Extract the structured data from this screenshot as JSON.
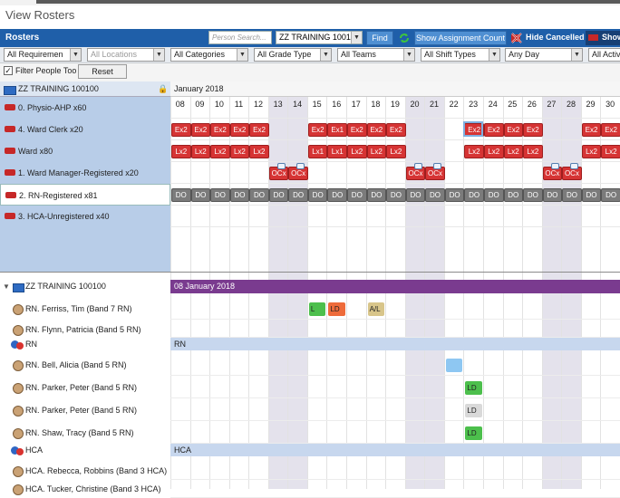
{
  "page_title": "View Rosters",
  "toolbar": {
    "title": "Rosters",
    "search_placeholder": "Person Search...",
    "roster_value": "ZZ TRAINING 10010",
    "find_label": "Find",
    "show_assignment_label": "Show Assignment Count",
    "hide_cancelled_label": "Hide Cancelled",
    "show_label": "Show"
  },
  "filters": {
    "dropdowns": [
      "All Requiremen",
      "All Locations",
      "All Categories",
      "All Grade Type",
      "All Teams",
      "All Shift Types",
      "Any Day",
      "All Activ"
    ],
    "filter_people_label": "Filter People Too",
    "reset_label": "Reset"
  },
  "requirements": {
    "group_name": "ZZ TRAINING 100100",
    "month_label": "January 2018",
    "days": [
      "08",
      "09",
      "10",
      "11",
      "12",
      "13",
      "14",
      "15",
      "16",
      "17",
      "18",
      "19",
      "20",
      "21",
      "22",
      "23",
      "24",
      "25",
      "26",
      "27",
      "28",
      "29",
      "30"
    ],
    "rows": [
      {
        "label": "0. Physio-AHP x60",
        "chips": [
          "",
          "",
          "",
          "",
          "",
          "",
          "",
          "",
          "",
          "",
          "",
          "",
          "",
          "",
          "",
          "",
          "",
          "",
          "",
          "",
          "",
          "",
          ""
        ]
      },
      {
        "label": "4. Ward Clerk x20",
        "chips": [
          "Ex2",
          "Ex2",
          "Ex2",
          "Ex2",
          "Ex2",
          "",
          "",
          "Ex2",
          "Ex1",
          "Ex2",
          "Ex2",
          "Ex2",
          "",
          "",
          "",
          "Ex2",
          "Ex2",
          "Ex2",
          "Ex2",
          "",
          "",
          "Ex2",
          "Ex2"
        ]
      },
      {
        "label": "Ward  x80",
        "chips": [
          "Lx2",
          "Lx2",
          "Lx2",
          "Lx2",
          "Lx2",
          "",
          "",
          "Lx1",
          "Lx1",
          "Lx2",
          "Lx2",
          "Lx2",
          "",
          "",
          "",
          "Lx2",
          "Lx2",
          "Lx2",
          "Lx2",
          "",
          "",
          "Lx2",
          "Lx2"
        ]
      },
      {
        "label": "1. Ward Manager-Registered x20",
        "chips": [
          "",
          "",
          "",
          "",
          "",
          "OCx",
          "OCx",
          "",
          "",
          "",
          "",
          "",
          "OCx",
          "OCx",
          "",
          "",
          "",
          "",
          "",
          "OCx",
          "OCx",
          "",
          ""
        ]
      },
      {
        "label": "2. RN-Registered x81",
        "chips": [
          "DO",
          "DO",
          "DO",
          "DO",
          "DO",
          "DO",
          "DO",
          "DO",
          "DO",
          "DO",
          "DO",
          "DO",
          "DO",
          "DO",
          "DO",
          "DO",
          "DO",
          "DO",
          "DO",
          "DO",
          "DO",
          "DO",
          "DO"
        ]
      },
      {
        "label": "3. HCA-Unregistered x40",
        "chips": [
          "",
          "",
          "",
          "",
          "",
          "",
          "",
          "",
          "",
          "",
          "",
          "",
          "",
          "",
          "",
          "",
          "",
          "",
          "",
          "",
          "",
          "",
          ""
        ]
      }
    ]
  },
  "people": {
    "group_name": "ZZ TRAINING 100100",
    "date_label": "08 January 2018",
    "rows": [
      {
        "type": "person",
        "label": "RN. Ferriss, Tim (Band 7 RN)",
        "shifts": [
          {
            "day": 7,
            "text": "L",
            "color": "#4cbf4c"
          },
          {
            "day": 8,
            "text": "LD",
            "color": "#ee6b3a"
          },
          {
            "day": 10,
            "text": "A/L",
            "color": "#d8c58a"
          }
        ]
      },
      {
        "type": "person",
        "label": "RN. Flynn, Patricia (Band 5 RN)",
        "shifts": []
      },
      {
        "type": "group",
        "label": "RN",
        "band": "RN"
      },
      {
        "type": "person",
        "label": "RN. Bell, Alicia (Band 5 RN)",
        "shifts": [
          {
            "day": 14,
            "text": "",
            "color": "#8ec7f2"
          }
        ]
      },
      {
        "type": "person",
        "label": "RN. Parker, Peter (Band 5 RN)",
        "shifts": [
          {
            "day": 15,
            "text": "LD",
            "color": "#4cbf4c"
          }
        ]
      },
      {
        "type": "person",
        "label": "RN. Parker, Peter (Band 5 RN)",
        "shifts": [
          {
            "day": 15,
            "text": "LD",
            "color": "#d9d9d9"
          }
        ]
      },
      {
        "type": "person",
        "label": "RN. Shaw, Tracy (Band 5 RN)",
        "shifts": [
          {
            "day": 15,
            "text": "LD",
            "color": "#4cbf4c"
          }
        ]
      },
      {
        "type": "group",
        "label": "HCA",
        "band": "HCA"
      },
      {
        "type": "person",
        "label": "HCA. Rebecca, Robbins (Band 3 HCA)",
        "shifts": []
      },
      {
        "type": "person",
        "label": "HCA. Tucker, Christine (Band 3 HCA)",
        "shifts": []
      }
    ]
  },
  "colors": {
    "header_blue": "#1f5fa9",
    "chip_red": "#d63434",
    "chip_grey": "#7b7b7b",
    "purple": "#7a3b8f",
    "left_panel": "#b8cde8"
  }
}
